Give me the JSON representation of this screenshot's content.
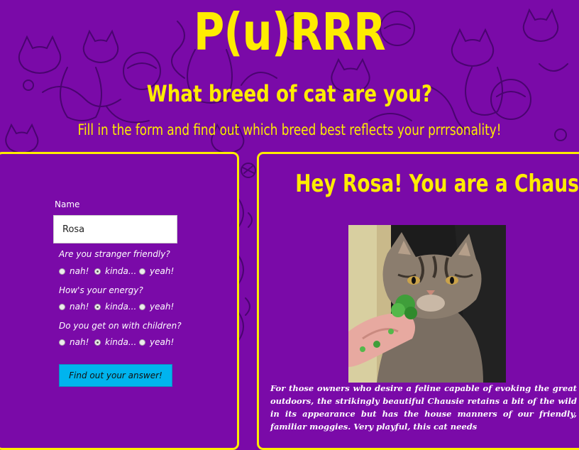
{
  "header": {
    "logo": "P(u)RRR",
    "tagline": "What breed of cat are you?",
    "subtagline": "Fill in the form and find out which breed best reflects your prrrsonality!"
  },
  "form": {
    "name_label": "Name",
    "name_value": "Rosa",
    "questions": [
      {
        "text": "Are you stranger friendly?",
        "options": [
          "nah!",
          "kinda...",
          "yeah!"
        ],
        "selected": "kinda..."
      },
      {
        "text": "How's your energy?",
        "options": [
          "nah!",
          "kinda...",
          "yeah!"
        ],
        "selected": "kinda..."
      },
      {
        "text": "Do you get on with children?",
        "options": [
          "nah!",
          "kinda...",
          "yeah!"
        ],
        "selected": "kinda..."
      }
    ],
    "submit_label": "Find out your answer!"
  },
  "result": {
    "title": "Hey Rosa! You are a Chausie",
    "description": "For those owners who desire a feline capable of evoking the great outdoors, the strikingly beautiful Chausie retains a bit of the wild in its appearance but has the house manners of our friendly, familiar moggies. Very playful, this cat needs"
  },
  "colors": {
    "background": "#7a0aa8",
    "accent": "#ffec00",
    "button": "#00b4ee",
    "pattern": "#4a0470"
  }
}
